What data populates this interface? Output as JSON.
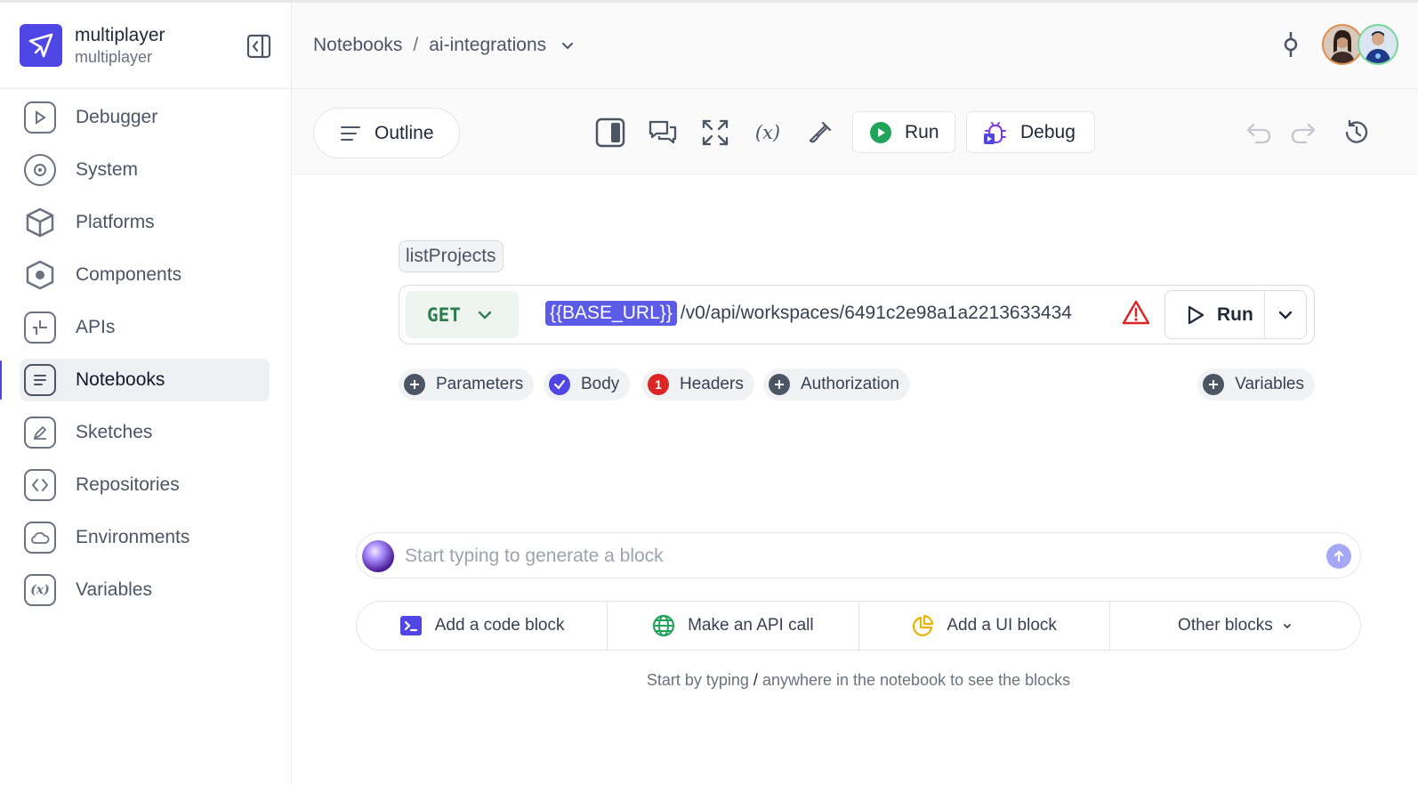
{
  "brand": {
    "name": "multiplayer",
    "subtitle": "multiplayer"
  },
  "sidebar": {
    "items": [
      {
        "label": "Debugger",
        "icon": "play-icon"
      },
      {
        "label": "System",
        "icon": "radar-icon"
      },
      {
        "label": "Platforms",
        "icon": "cube-icon"
      },
      {
        "label": "Components",
        "icon": "hexagon-icon"
      },
      {
        "label": "APIs",
        "icon": "api-icon"
      },
      {
        "label": "Notebooks",
        "icon": "notebook-icon",
        "active": true
      },
      {
        "label": "Sketches",
        "icon": "pencil-icon"
      },
      {
        "label": "Repositories",
        "icon": "code-icon"
      },
      {
        "label": "Environments",
        "icon": "cloud-icon"
      },
      {
        "label": "Variables",
        "icon": "variable-icon"
      }
    ]
  },
  "breadcrumb": {
    "root": "Notebooks",
    "separator": "/",
    "current": "ai-integrations"
  },
  "toolbar": {
    "outline_label": "Outline",
    "variable_symbol": "(x)",
    "run_label": "Run",
    "debug_label": "Debug"
  },
  "request": {
    "block_name": "listProjects",
    "method": "GET",
    "url_variable": "{{BASE_URL}}",
    "url_path": "/v0/api/workspaces/6491c2e98a1a2213633434",
    "run_label": "Run"
  },
  "chips": {
    "parameters": "Parameters",
    "body": "Body",
    "headers": "Headers",
    "headers_count": "1",
    "authorization": "Authorization",
    "variables": "Variables"
  },
  "prompt": {
    "placeholder": "Start typing to generate a block"
  },
  "block_actions": {
    "code": "Add a code block",
    "api": "Make an API call",
    "ui": "Add a UI block",
    "other": "Other blocks"
  },
  "hint": {
    "before": "Start by typing",
    "key": "/",
    "after": "anywhere in the notebook to see the blocks"
  },
  "colors": {
    "accent": "#4f46e5",
    "method_green": "#2e7d4f",
    "warning_red": "#dc2626",
    "run_green": "#22a35a"
  }
}
